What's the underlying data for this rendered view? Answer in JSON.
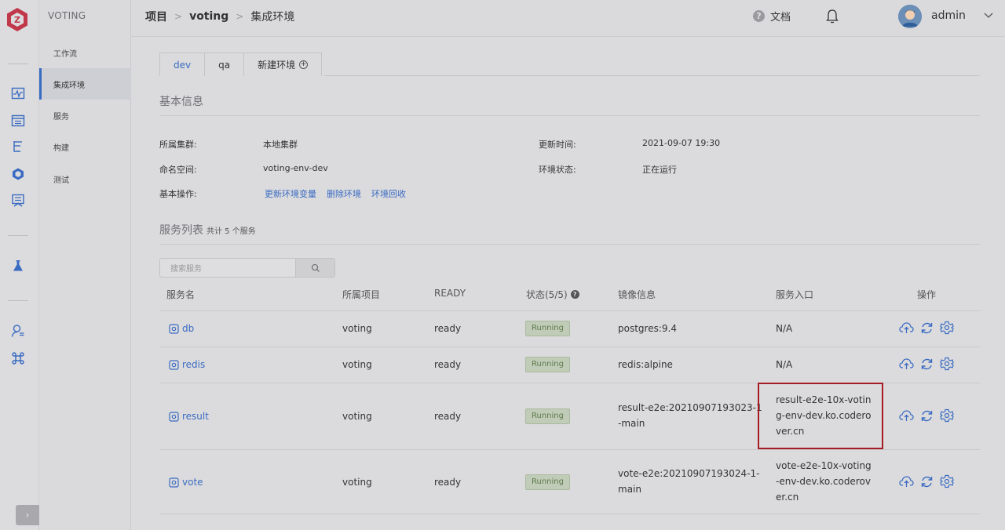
{
  "project_name": "VOTING",
  "menu": {
    "items": [
      {
        "label": "工作流",
        "active": false
      },
      {
        "label": "集成环境",
        "active": true
      },
      {
        "label": "服务",
        "active": false
      },
      {
        "label": "构建",
        "active": false
      },
      {
        "label": "测试",
        "active": false
      }
    ]
  },
  "header": {
    "breadcrumb": [
      "项目",
      "voting",
      "集成环境"
    ],
    "docs_label": "文档",
    "username": "admin"
  },
  "tabs": [
    {
      "label": "dev",
      "active": true
    },
    {
      "label": "qa",
      "active": false
    },
    {
      "label": "新建环境",
      "active": false
    }
  ],
  "basic": {
    "title": "基本信息",
    "cluster_label": "所属集群:",
    "cluster_value": "本地集群",
    "namespace_label": "命名空间:",
    "namespace_value": "voting-env-dev",
    "ops_label": "基本操作:",
    "ops": [
      "更新环境变量",
      "删除环境",
      "环境回收"
    ],
    "updated_label": "更新时间:",
    "updated_value": "2021-09-07 19:30",
    "status_label": "环境状态:",
    "status_value": "正在运行"
  },
  "services": {
    "title": "服务列表",
    "subtitle": "共计 5 个服务",
    "search_placeholder": "搜索服务",
    "columns": [
      "服务名",
      "所属项目",
      "READY",
      "状态(5/5)",
      "镜像信息",
      "服务入口",
      "操作"
    ],
    "rows": [
      {
        "name": "db",
        "project": "voting",
        "ready": "ready",
        "status": "Running",
        "image": "postgres:9.4",
        "entry": "N/A"
      },
      {
        "name": "redis",
        "project": "voting",
        "ready": "ready",
        "status": "Running",
        "image": "redis:alpine",
        "entry": "N/A"
      },
      {
        "name": "result",
        "project": "voting",
        "ready": "ready",
        "status": "Running",
        "image": "result-e2e:20210907193023-1-main",
        "entry": "result-e2e-10x-voting-env-dev.ko.coderover.cn"
      },
      {
        "name": "vote",
        "project": "voting",
        "ready": "ready",
        "status": "Running",
        "image": "vote-e2e:20210907193024-1-main",
        "entry": "vote-e2e-10x-voting-env-dev.ko.coderover.cn"
      }
    ]
  },
  "colors": {
    "accent": "#3a6bc2",
    "highlight": "#a51c24",
    "running_bg": "#c1ccb8"
  }
}
